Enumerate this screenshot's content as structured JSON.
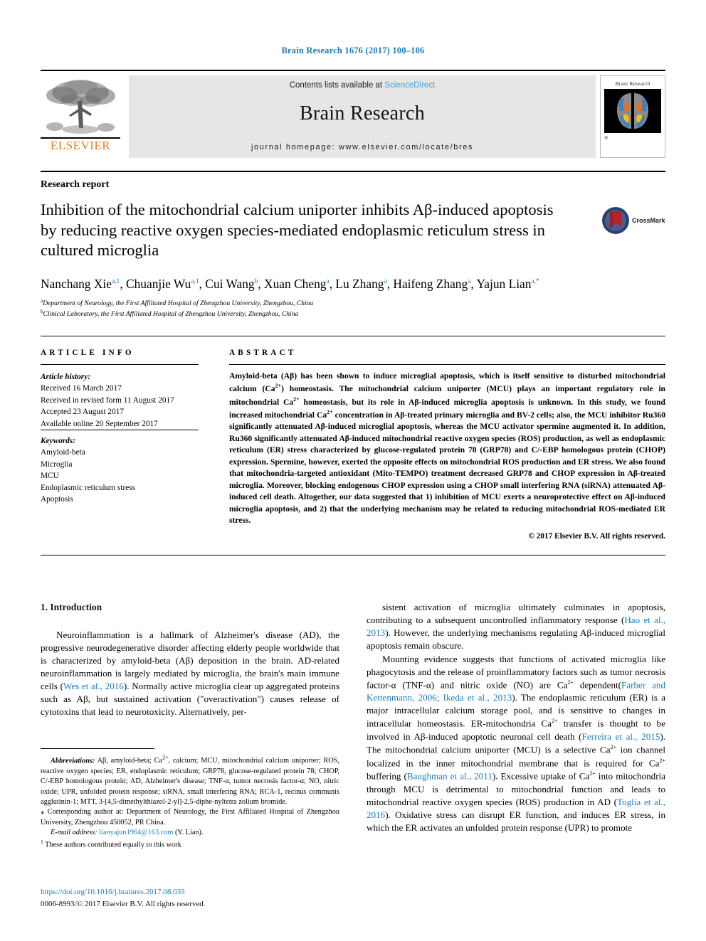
{
  "running_head": "Brain Research 1676 (2017) 100–106",
  "masthead": {
    "publisher": "ELSEVIER",
    "contents_prefix": "Contents lists available at ",
    "contents_link": "ScienceDirect",
    "journal_title": "Brain Research",
    "homepage": "journal homepage: www.elsevier.com/locate/bres",
    "cover_title": "Brain Research"
  },
  "article": {
    "type": "Research report",
    "title": "Inhibition of the mitochondrial calcium uniporter inhibits Aβ-induced apoptosis by reducing reactive oxygen species-mediated endoplasmic reticulum stress in cultured microglia",
    "crossmark_label": "CrossMark"
  },
  "authors": {
    "list": [
      {
        "name": "Nanchang Xie",
        "marks": "a,1"
      },
      {
        "name": "Chuanjie Wu",
        "marks": "a,1"
      },
      {
        "name": "Cui Wang",
        "marks": "b"
      },
      {
        "name": "Xuan Cheng",
        "marks": "a"
      },
      {
        "name": "Lu Zhang",
        "marks": "a"
      },
      {
        "name": "Haifeng Zhang",
        "marks": "a"
      },
      {
        "name": "Yajun Lian",
        "marks": "a,*"
      }
    ],
    "affiliations": [
      {
        "mark": "a",
        "text": "Department of Neurology, the First Affiliated Hospital of Zhengzhou University, Zhengzhou, China"
      },
      {
        "mark": "b",
        "text": "Clinical Laboratory, the First Affiliated Hospital of Zhengzhou University, Zhengzhou, China"
      }
    ]
  },
  "sections": {
    "info_heading": "ARTICLE INFO",
    "abstract_heading": "ABSTRACT"
  },
  "article_info": {
    "history_label": "Article history:",
    "history": [
      "Received 16 March 2017",
      "Received in revised form 11 August 2017",
      "Accepted 23 August 2017",
      "Available online 20 September 2017"
    ],
    "keywords_label": "Keywords:",
    "keywords": [
      "Amyloid-beta",
      "Microglia",
      "MCU",
      "Endoplasmic reticulum stress",
      "Apoptosis"
    ]
  },
  "abstract": {
    "text": "Amyloid-beta (Aβ) has been shown to induce microglial apoptosis, which is itself sensitive to disturbed mitochondrial calcium (Ca2+) homeostasis. The mitochondrial calcium uniporter (MCU) plays an important regulatory role in mitochondrial Ca2+ homeostasis, but its role in Aβ-induced microglia apoptosis is unknown. In this study, we found increased mitochondrial Ca2+ concentration in Aβ-treated primary microglia and BV-2 cells; also, the MCU inhibitor Ru360 significantly attenuated Aβ-induced microglial apoptosis, whereas the MCU activator spermine augmented it. In addition, Ru360 significantly attenuated Aβ-induced mitochondrial reactive oxygen species (ROS) production, as well as endoplasmic reticulum (ER) stress characterized by glucose-regulated protein 78 (GRP78) and C/-EBP homologous protein (CHOP) expression. Spermine, however, exerted the opposite effects on mitochondrial ROS production and ER stress. We also found that mitochondria-targeted antioxidant (Mito-TEMPO) treatment decreased GRP78 and CHOP expression in Aβ-treated microglia. Moreover, blocking endogenous CHOP expression using a CHOP small interfering RNA (siRNA) attenuated Aβ-induced cell death. Altogether, our data suggested that 1) inhibition of MCU exerts a neuroprotective effect on Aβ-induced microglia apoptosis, and 2) that the underlying mechanism may be related to reducing mitochondrial ROS-mediated ER stress.",
    "copyright": "© 2017 Elsevier B.V. All rights reserved."
  },
  "body": {
    "intro_heading": "1. Introduction",
    "left_paragraph": "Neuroinflammation is a hallmark of Alzheimer's disease (AD), the progressive neurodegenerative disorder affecting elderly people worldwide that is characterized by amyloid-beta (Aβ) deposition in the brain. AD-related neuroinflammation is largely mediated by microglia, the brain's main immune cells (Wes et al., 2016). Normally active microglia clear up aggregated proteins such as Aβ, but sustained activation (\"overactivation\") causes release of cytotoxins that lead to neurotoxicity. Alternatively, per-",
    "right_paragraph_1": "sistent activation of microglia ultimately culminates in apoptosis, contributing to a subsequent uncontrolled inflammatory response (Hao et al., 2013). However, the underlying mechanisms regulating Aβ-induced microglial apoptosis remain obscure.",
    "right_paragraph_2": "Mounting evidence suggests that functions of activated microglia like phagocytosis and the release of proinflammatory factors such as tumor necrosis factor-α (TNF-α) and nitric oxide (NO) are Ca2+ dependent(Farber and Kettenmann, 2006; Ikeda et al., 2013). The endoplasmic reticulum (ER) is a major intracellular calcium storage pool, and is sensitive to changes in intracellular homeostasis. ER-mitochondria Ca2+ transfer is thought to be involved in Aβ-induced apoptotic neuronal cell death (Ferreira et al., 2015). The mitochondrial calcium uniporter (MCU) is a selective Ca2+ ion channel localized in the inner mitochondrial membrane that is required for Ca2+ buffering (Baughman et al., 2011). Excessive uptake of Ca2+ into mitochondria through MCU is detrimental to mitochondrial function and leads to mitochondrial reactive oxygen species (ROS) production in AD (Toglia et al., 2016). Oxidative stress can disrupt ER function, and induces ER stress, in which the ER activates an unfolded protein response (UPR) to promote"
  },
  "footnotes": {
    "abbreviations_label": "Abbreviations:",
    "abbreviations_text": "Aβ, amyloid-beta; Ca2+, calcium; MCU, mitochondrial calcium uniporter; ROS, reactive oxygen species; ER, endoplasmic reticulum; GRP78, glucose-regulated protein 78; CHOP, C/-EBP homologous protein; AD, Alzheimer's disease; TNF-α, tumor necrosis factor-α; NO, nitric oxide; UPR, unfolded protein response; siRNA, small interfering RNA; RCA-1, recinus communis agglutinin-1; MTT, 3-[4,5-dimethylthiazol-2-yl]-2,5-diphe-nyltetra zolium bromide.",
    "corresponding": "Corresponding author at: Department of Neurology, the First Affiliated Hospital of Zhengzhou University, Zhengzhou 450052, PR China.",
    "email_label": "E-mail address:",
    "email": "lianyajun1964@163.com",
    "email_suffix": "(Y. Lian).",
    "equal_contrib": "These authors contributed equally to this work",
    "doi": "https://doi.org/10.1016/j.brainres.2017.08.035",
    "issn": "0006-8993/© 2017 Elsevier B.V. All rights reserved."
  },
  "colors": {
    "link_blue": "#1a7db6",
    "sciencedirect_blue": "#3aa3d8",
    "elsevier_orange": "#f07c1b",
    "banner_gray": "#e6e6e6"
  }
}
